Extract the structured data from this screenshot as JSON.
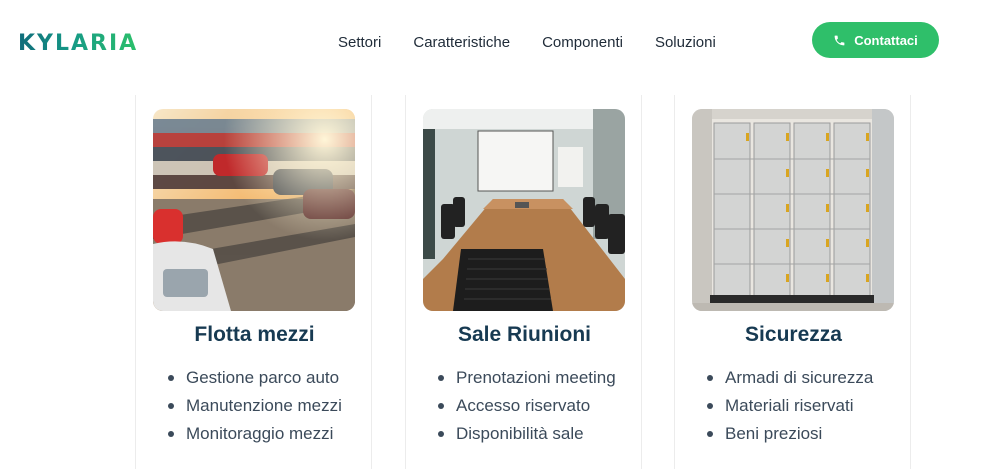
{
  "brand": {
    "name": "KYLARIA"
  },
  "nav": {
    "items": [
      "Settori",
      "Caratteristiche",
      "Componenti",
      "Soluzioni"
    ]
  },
  "cta": {
    "label": "Contattaci",
    "icon": "phone-icon",
    "color": "#2fbf6a"
  },
  "colors": {
    "title": "#173a52",
    "accent": "#2fbf6a"
  },
  "cards": [
    {
      "title": "Flotta mezzi",
      "image": "parked-cars-photo",
      "items": [
        "Gestione parco auto",
        "Manutenzione mezzi",
        "Monitoraggio mezzi"
      ]
    },
    {
      "title": "Sale Riunioni",
      "image": "meeting-room-photo",
      "items": [
        "Prenotazioni meeting",
        "Accesso riservato",
        "Disponibilità sale"
      ]
    },
    {
      "title": "Sicurezza",
      "image": "lockers-photo",
      "items": [
        "Armadi di sicurezza",
        "Materiali riservati",
        "Beni preziosi"
      ]
    }
  ]
}
